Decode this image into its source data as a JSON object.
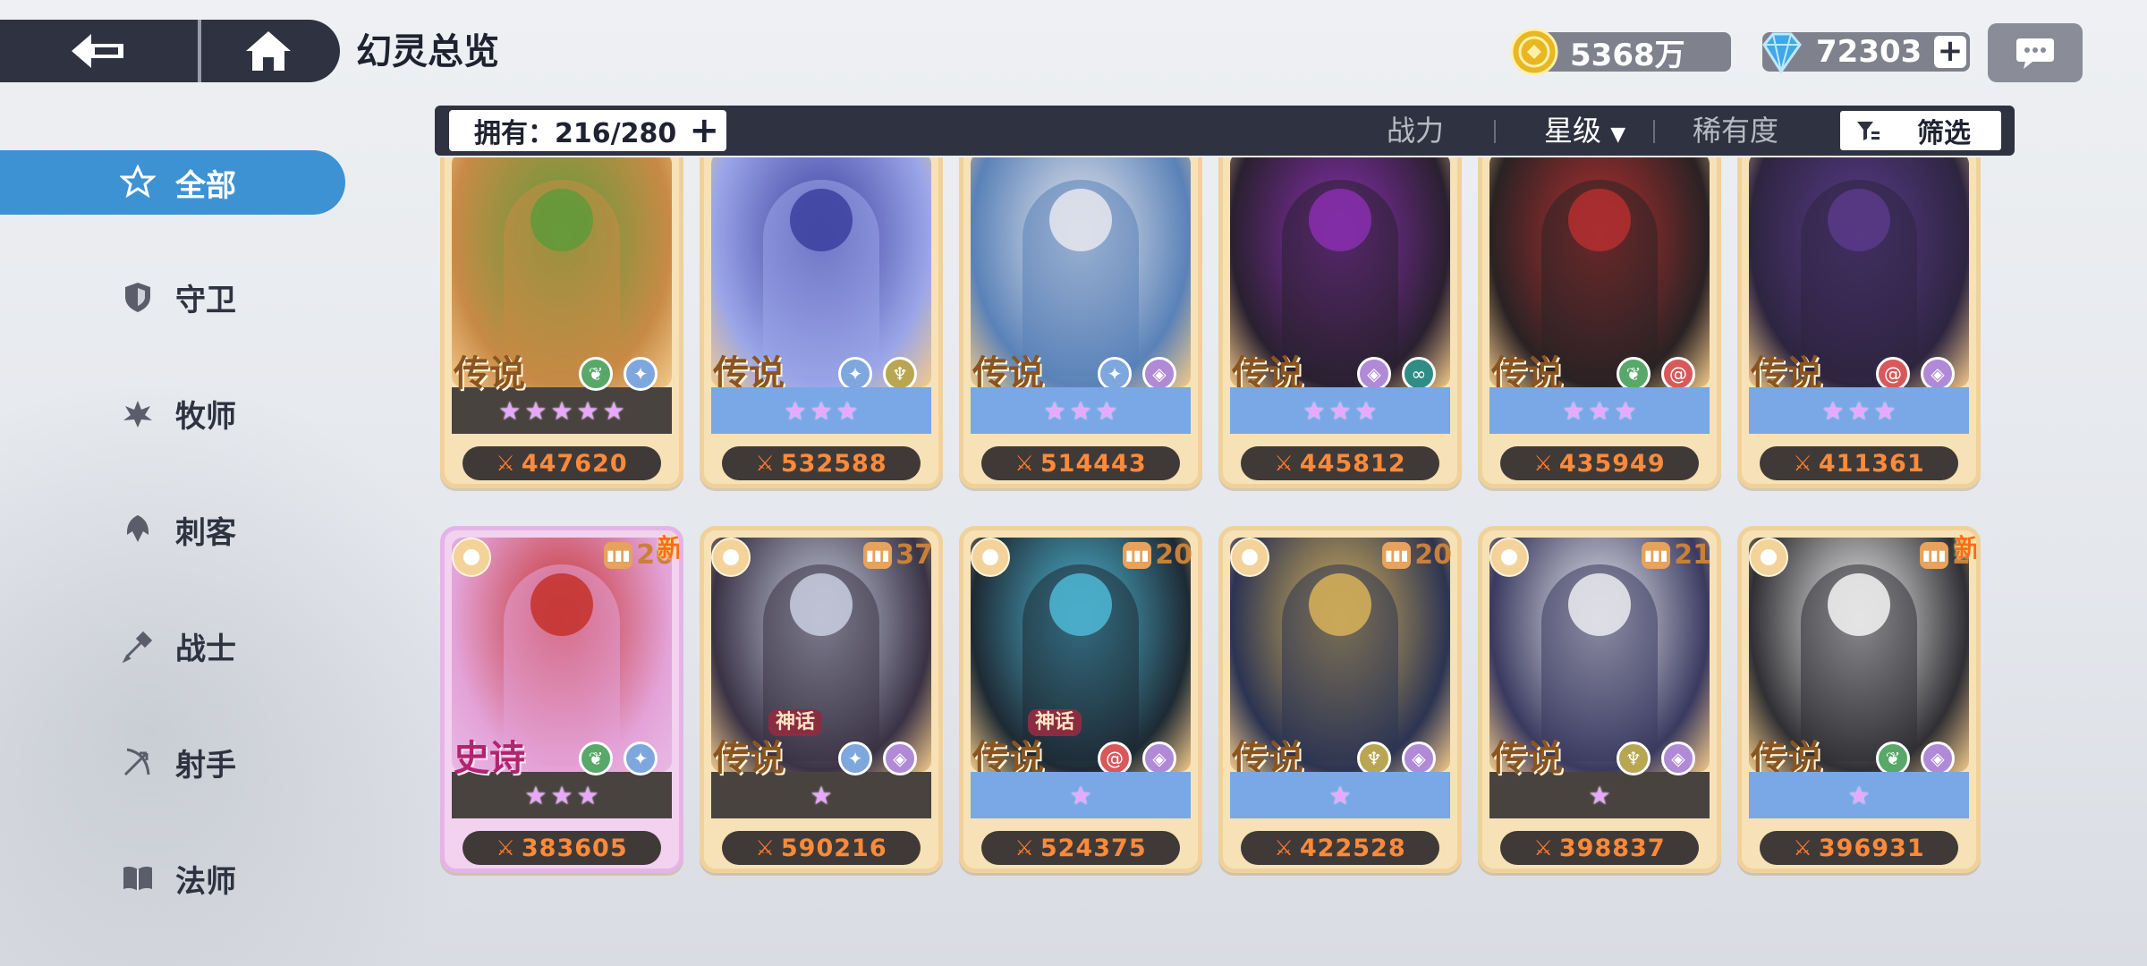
{
  "header": {
    "title": "幻灵总览",
    "gold": "5368万",
    "gems": "72303",
    "plus": "+"
  },
  "filter_bar": {
    "owned": "拥有：216/280",
    "owned_plus": "+",
    "sort_power": "战力",
    "sort_star": "星级",
    "sort_star_arrow": "▼",
    "sort_rarity": "稀有度",
    "filter_label": "筛选"
  },
  "sidebar": {
    "items": [
      {
        "label": "全部",
        "icon": "all-classes-icon",
        "active": true
      },
      {
        "label": "守卫",
        "icon": "shield-icon"
      },
      {
        "label": "牧师",
        "icon": "priest-icon"
      },
      {
        "label": "刺客",
        "icon": "assassin-icon"
      },
      {
        "label": "战士",
        "icon": "warrior-icon"
      },
      {
        "label": "射手",
        "icon": "archer-icon"
      },
      {
        "label": "法师",
        "icon": "book-icon"
      }
    ]
  },
  "cards": [
    {
      "rarity": "传说",
      "myth": "",
      "stars": 5,
      "star_bg": "dark",
      "power": "447620",
      "elements": [
        "nature",
        "frost"
      ],
      "level": "",
      "new": "",
      "colors": [
        "#5f9a3a",
        "#c88a46"
      ]
    },
    {
      "rarity": "传说",
      "myth": "",
      "stars": 3,
      "star_bg": "blue",
      "power": "532588",
      "elements": [
        "frost",
        "holy"
      ],
      "level": "",
      "new": "",
      "colors": [
        "#3b3f9e",
        "#9aa6e8"
      ]
    },
    {
      "rarity": "传说",
      "myth": "",
      "stars": 3,
      "star_bg": "blue",
      "power": "514443",
      "elements": [
        "frost",
        "void"
      ],
      "level": "",
      "new": "",
      "colors": [
        "#e8e8ee",
        "#5a82b8"
      ]
    },
    {
      "rarity": "传说",
      "myth": "",
      "stars": 3,
      "star_bg": "blue",
      "power": "445812",
      "elements": [
        "void",
        "tide"
      ],
      "level": "",
      "new": "",
      "colors": [
        "#8a2fb0",
        "#2a2030"
      ]
    },
    {
      "rarity": "传说",
      "myth": "",
      "stars": 3,
      "star_bg": "blue",
      "power": "435949",
      "elements": [
        "nature",
        "fire"
      ],
      "level": "",
      "new": "",
      "colors": [
        "#b52f2f",
        "#2a2224"
      ]
    },
    {
      "rarity": "传说",
      "myth": "",
      "stars": 3,
      "star_bg": "blue",
      "power": "411361",
      "elements": [
        "fire",
        "void"
      ],
      "level": "",
      "new": "",
      "colors": [
        "#5a3a8a",
        "#2d2540"
      ]
    },
    {
      "rarity": "史诗",
      "myth": "",
      "stars": 3,
      "star_bg": "dark",
      "power": "383605",
      "elements": [
        "nature",
        "frost"
      ],
      "level": "26",
      "new": "新",
      "colors": [
        "#c4302a",
        "#e4a3d8"
      ],
      "epic": true
    },
    {
      "rarity": "传说",
      "myth": "神话",
      "stars": 1,
      "star_bg": "dark",
      "power": "590216",
      "elements": [
        "frost",
        "void"
      ],
      "level": "37",
      "new": "",
      "colors": [
        "#c9cfe0",
        "#3a3346"
      ]
    },
    {
      "rarity": "传说",
      "myth": "神话",
      "stars": 1,
      "star_bg": "blue",
      "power": "524375",
      "elements": [
        "fire",
        "void"
      ],
      "level": "20",
      "new": "",
      "colors": [
        "#4fb8d6",
        "#1e2a34"
      ]
    },
    {
      "rarity": "传说",
      "myth": "",
      "stars": 1,
      "star_bg": "blue",
      "power": "422528",
      "elements": [
        "holy",
        "void"
      ],
      "level": "20",
      "new": "",
      "colors": [
        "#d8b35a",
        "#2c3452"
      ]
    },
    {
      "rarity": "传说",
      "myth": "",
      "stars": 1,
      "star_bg": "dark",
      "power": "398837",
      "elements": [
        "holy",
        "void"
      ],
      "level": "21",
      "new": "",
      "colors": [
        "#ececf2",
        "#3a3a60"
      ]
    },
    {
      "rarity": "传说",
      "myth": "",
      "stars": 1,
      "star_bg": "blue",
      "power": "396931",
      "elements": [
        "nature",
        "void"
      ],
      "level": "2",
      "new": "新",
      "colors": [
        "#f4f4f4",
        "#303034"
      ]
    }
  ],
  "colors": {
    "accent": "#3d92d4",
    "bar": "#2f3240",
    "power_text": "#ff8a3a"
  }
}
